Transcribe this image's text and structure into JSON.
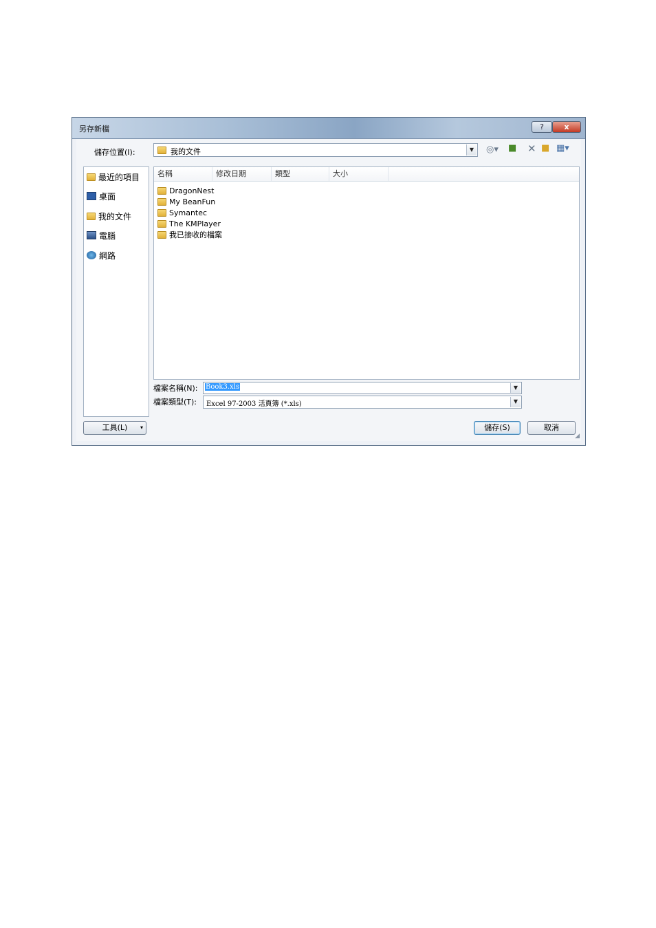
{
  "dialog": {
    "title": "另存新檔",
    "help_label": "?",
    "close_label": "x"
  },
  "location": {
    "label": "儲存位置(I):",
    "value": "我的文件"
  },
  "places": [
    {
      "label": "最近的項目",
      "icon": "folder-icon"
    },
    {
      "label": "桌面",
      "icon": "desktop-icon"
    },
    {
      "label": "我的文件",
      "icon": "documents-icon"
    },
    {
      "label": "電腦",
      "icon": "computer-icon"
    },
    {
      "label": "網路",
      "icon": "network-icon"
    }
  ],
  "columns": [
    "名稱",
    "修改日期",
    "類型",
    "大小"
  ],
  "files": [
    "DragonNest",
    "My BeanFun",
    "Symantec",
    "The KMPlayer",
    "我已接收的檔案"
  ],
  "filename": {
    "label": "檔案名稱(N):",
    "value": "Book3.xls"
  },
  "filetype": {
    "label": "檔案類型(T):",
    "value": "Excel 97-2003 活頁簿 (*.xls)"
  },
  "buttons": {
    "tools": "工具(L)",
    "save": "儲存(S)",
    "cancel": "取消"
  }
}
